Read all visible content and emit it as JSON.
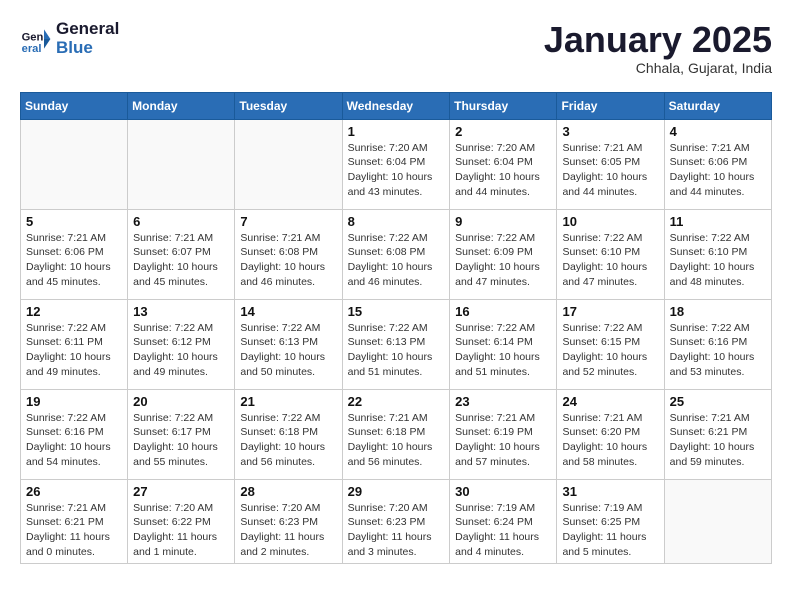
{
  "header": {
    "logo_line1": "General",
    "logo_line2": "Blue",
    "month_title": "January 2025",
    "subtitle": "Chhala, Gujarat, India"
  },
  "weekdays": [
    "Sunday",
    "Monday",
    "Tuesday",
    "Wednesday",
    "Thursday",
    "Friday",
    "Saturday"
  ],
  "weeks": [
    [
      {
        "day": "",
        "info": ""
      },
      {
        "day": "",
        "info": ""
      },
      {
        "day": "",
        "info": ""
      },
      {
        "day": "1",
        "info": "Sunrise: 7:20 AM\nSunset: 6:04 PM\nDaylight: 10 hours\nand 43 minutes."
      },
      {
        "day": "2",
        "info": "Sunrise: 7:20 AM\nSunset: 6:04 PM\nDaylight: 10 hours\nand 44 minutes."
      },
      {
        "day": "3",
        "info": "Sunrise: 7:21 AM\nSunset: 6:05 PM\nDaylight: 10 hours\nand 44 minutes."
      },
      {
        "day": "4",
        "info": "Sunrise: 7:21 AM\nSunset: 6:06 PM\nDaylight: 10 hours\nand 44 minutes."
      }
    ],
    [
      {
        "day": "5",
        "info": "Sunrise: 7:21 AM\nSunset: 6:06 PM\nDaylight: 10 hours\nand 45 minutes."
      },
      {
        "day": "6",
        "info": "Sunrise: 7:21 AM\nSunset: 6:07 PM\nDaylight: 10 hours\nand 45 minutes."
      },
      {
        "day": "7",
        "info": "Sunrise: 7:21 AM\nSunset: 6:08 PM\nDaylight: 10 hours\nand 46 minutes."
      },
      {
        "day": "8",
        "info": "Sunrise: 7:22 AM\nSunset: 6:08 PM\nDaylight: 10 hours\nand 46 minutes."
      },
      {
        "day": "9",
        "info": "Sunrise: 7:22 AM\nSunset: 6:09 PM\nDaylight: 10 hours\nand 47 minutes."
      },
      {
        "day": "10",
        "info": "Sunrise: 7:22 AM\nSunset: 6:10 PM\nDaylight: 10 hours\nand 47 minutes."
      },
      {
        "day": "11",
        "info": "Sunrise: 7:22 AM\nSunset: 6:10 PM\nDaylight: 10 hours\nand 48 minutes."
      }
    ],
    [
      {
        "day": "12",
        "info": "Sunrise: 7:22 AM\nSunset: 6:11 PM\nDaylight: 10 hours\nand 49 minutes."
      },
      {
        "day": "13",
        "info": "Sunrise: 7:22 AM\nSunset: 6:12 PM\nDaylight: 10 hours\nand 49 minutes."
      },
      {
        "day": "14",
        "info": "Sunrise: 7:22 AM\nSunset: 6:13 PM\nDaylight: 10 hours\nand 50 minutes."
      },
      {
        "day": "15",
        "info": "Sunrise: 7:22 AM\nSunset: 6:13 PM\nDaylight: 10 hours\nand 51 minutes."
      },
      {
        "day": "16",
        "info": "Sunrise: 7:22 AM\nSunset: 6:14 PM\nDaylight: 10 hours\nand 51 minutes."
      },
      {
        "day": "17",
        "info": "Sunrise: 7:22 AM\nSunset: 6:15 PM\nDaylight: 10 hours\nand 52 minutes."
      },
      {
        "day": "18",
        "info": "Sunrise: 7:22 AM\nSunset: 6:16 PM\nDaylight: 10 hours\nand 53 minutes."
      }
    ],
    [
      {
        "day": "19",
        "info": "Sunrise: 7:22 AM\nSunset: 6:16 PM\nDaylight: 10 hours\nand 54 minutes."
      },
      {
        "day": "20",
        "info": "Sunrise: 7:22 AM\nSunset: 6:17 PM\nDaylight: 10 hours\nand 55 minutes."
      },
      {
        "day": "21",
        "info": "Sunrise: 7:22 AM\nSunset: 6:18 PM\nDaylight: 10 hours\nand 56 minutes."
      },
      {
        "day": "22",
        "info": "Sunrise: 7:21 AM\nSunset: 6:18 PM\nDaylight: 10 hours\nand 56 minutes."
      },
      {
        "day": "23",
        "info": "Sunrise: 7:21 AM\nSunset: 6:19 PM\nDaylight: 10 hours\nand 57 minutes."
      },
      {
        "day": "24",
        "info": "Sunrise: 7:21 AM\nSunset: 6:20 PM\nDaylight: 10 hours\nand 58 minutes."
      },
      {
        "day": "25",
        "info": "Sunrise: 7:21 AM\nSunset: 6:21 PM\nDaylight: 10 hours\nand 59 minutes."
      }
    ],
    [
      {
        "day": "26",
        "info": "Sunrise: 7:21 AM\nSunset: 6:21 PM\nDaylight: 11 hours\nand 0 minutes."
      },
      {
        "day": "27",
        "info": "Sunrise: 7:20 AM\nSunset: 6:22 PM\nDaylight: 11 hours\nand 1 minute."
      },
      {
        "day": "28",
        "info": "Sunrise: 7:20 AM\nSunset: 6:23 PM\nDaylight: 11 hours\nand 2 minutes."
      },
      {
        "day": "29",
        "info": "Sunrise: 7:20 AM\nSunset: 6:23 PM\nDaylight: 11 hours\nand 3 minutes."
      },
      {
        "day": "30",
        "info": "Sunrise: 7:19 AM\nSunset: 6:24 PM\nDaylight: 11 hours\nand 4 minutes."
      },
      {
        "day": "31",
        "info": "Sunrise: 7:19 AM\nSunset: 6:25 PM\nDaylight: 11 hours\nand 5 minutes."
      },
      {
        "day": "",
        "info": ""
      }
    ]
  ]
}
